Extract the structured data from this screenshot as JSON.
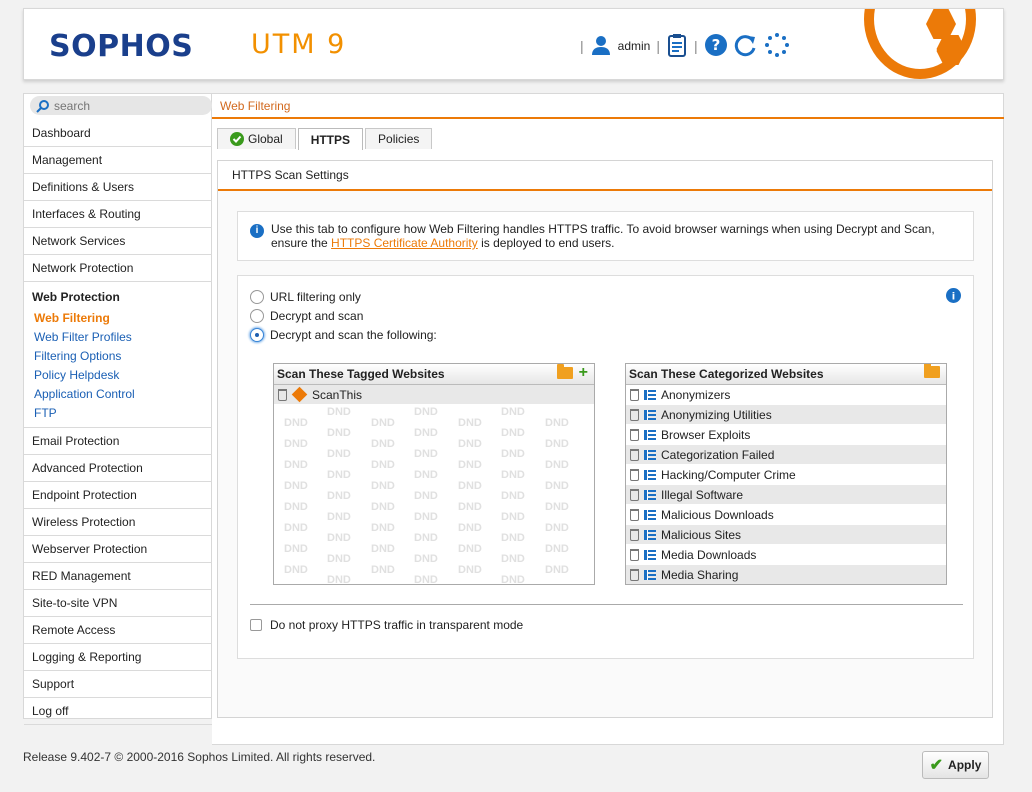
{
  "header": {
    "brand": "SOPHOS",
    "product": "UTM 9",
    "user": "admin",
    "colors": {
      "brand": "#1a3f8c",
      "accent": "#ec7a08"
    },
    "icons": [
      "user-icon",
      "clipboard-icon",
      "help-icon",
      "reload-icon",
      "spinner-icon",
      "sophos-badge-icon"
    ]
  },
  "search": {
    "placeholder": "search"
  },
  "sidebar": {
    "items": [
      {
        "label": "Dashboard"
      },
      {
        "label": "Management"
      },
      {
        "label": "Definitions & Users"
      },
      {
        "label": "Interfaces & Routing"
      },
      {
        "label": "Network Services"
      },
      {
        "label": "Network Protection"
      },
      {
        "label": "Web Protection",
        "sub": [
          {
            "label": "Web Filtering"
          },
          {
            "label": "Web Filter Profiles"
          },
          {
            "label": "Filtering Options"
          },
          {
            "label": "Policy Helpdesk"
          },
          {
            "label": "Application Control"
          },
          {
            "label": "FTP"
          }
        ]
      },
      {
        "label": "Email Protection"
      },
      {
        "label": "Advanced Protection"
      },
      {
        "label": "Endpoint Protection"
      },
      {
        "label": "Wireless Protection"
      },
      {
        "label": "Webserver Protection"
      },
      {
        "label": "RED Management"
      },
      {
        "label": "Site-to-site VPN"
      },
      {
        "label": "Remote Access"
      },
      {
        "label": "Logging & Reporting"
      },
      {
        "label": "Support"
      },
      {
        "label": "Log off"
      }
    ]
  },
  "breadcrumb": "Web Filtering",
  "tabs": [
    "Global",
    "HTTPS",
    "Policies"
  ],
  "panel": {
    "title": "HTTPS Scan Settings",
    "info_text_1": "Use this tab to configure how Web Filtering handles HTTPS traffic. To avoid browser warnings when using Decrypt and Scan,",
    "info_text_2_pre": "ensure the ",
    "info_link": "HTTPS Certificate Authority",
    "info_text_2_post": " is deployed to end users.",
    "radios": [
      "URL filtering only",
      "Decrypt and scan",
      "Decrypt and scan the following:"
    ],
    "selected_radio": "Decrypt and scan the following:",
    "tagged_title": "Scan These Tagged Websites",
    "tagged_items": [
      "ScanThis"
    ],
    "dnd": "DND",
    "categorized_title": "Scan These Categorized Websites",
    "categorized_items": [
      "Anonymizers",
      "Anonymizing Utilities",
      "Browser Exploits",
      "Categorization Failed",
      "Hacking/Computer Crime",
      "Illegal Software",
      "Malicious Downloads",
      "Malicious Sites",
      "Media Downloads",
      "Media Sharing"
    ],
    "transparent_label": "Do not proxy HTTPS traffic in transparent mode",
    "apply": "Apply"
  },
  "footer": "Release 9.402-7  © 2000-2016 Sophos Limited. All rights reserved."
}
